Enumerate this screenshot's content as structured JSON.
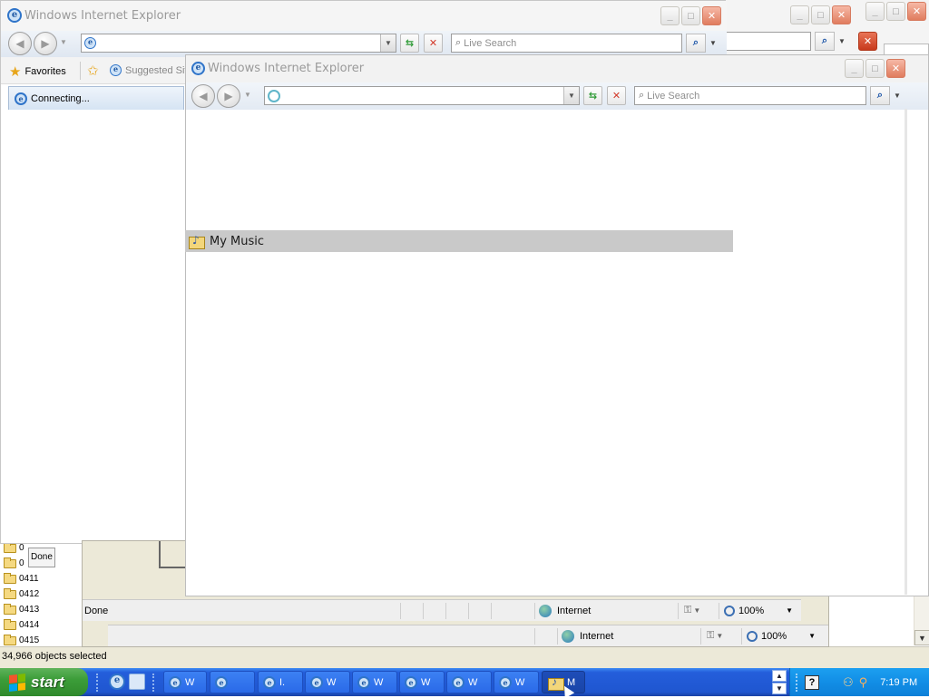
{
  "explorer": {
    "folders": [
      "0",
      "0",
      "0411",
      "0412",
      "0413",
      "0414",
      "0415"
    ],
    "status": "34,966 objects selected",
    "inner_status": "Done"
  },
  "ie_front": {
    "title": "Windows Internet Explorer",
    "address_value": "",
    "search_placeholder": "Live Search"
  },
  "ie_back1": {
    "title": "Windows Internet Explorer",
    "address_value": "",
    "search_placeholder": "Live Search",
    "favorites_label": "Favorites",
    "suggested_label": "Suggested Sit",
    "tab_label": "Connecting..."
  },
  "ie_status_a": {
    "left": "Done",
    "zone": "Internet",
    "zoom": "100%"
  },
  "ie_status_b": {
    "left": "",
    "zone": "Internet",
    "zoom": "100%"
  },
  "drag_ghost": {
    "label": "My Music"
  },
  "taskbar": {
    "start_label": "start",
    "buttons": [
      "W",
      "",
      "I.",
      "W",
      "W",
      "W",
      "W",
      "W",
      "M"
    ],
    "clock": "7:19 PM"
  },
  "colors": {
    "taskbar_blue": "#245edb",
    "start_green": "#3c9d39",
    "close_red": "#e07c5e"
  }
}
